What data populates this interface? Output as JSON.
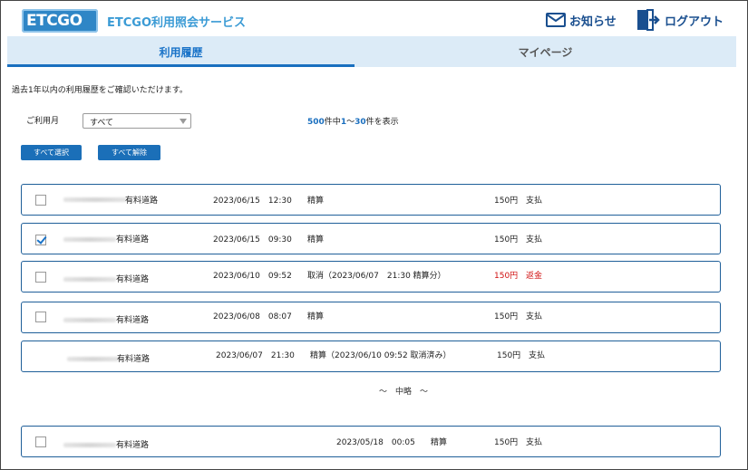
{
  "header": {
    "logo_text": "ETCGO",
    "app_title": "ETCGO利用照会サービス",
    "notice_label": "お知らせ",
    "logout_label": "ログアウト"
  },
  "tabs": [
    {
      "label": "利用履歴",
      "active": true
    },
    {
      "label": "マイページ",
      "active": false
    }
  ],
  "intro_text": "過去1年以内の利用履歴をご確認いただけます。",
  "filter": {
    "month_label": "ご利用月",
    "month_value": "すべて"
  },
  "count": {
    "total": "500",
    "total_suffix": "件中",
    "range_start": "1",
    "range_sep": "～",
    "range_end": "30",
    "range_suffix": "件を表示"
  },
  "buttons": {
    "select_all": "すべて選択",
    "deselect_all": "すべて解除"
  },
  "rows": [
    {
      "road": "有料道路",
      "datetime": "2023/06/15　12:30",
      "type": "精算",
      "amount": "150円",
      "status": "支払",
      "checked": false,
      "has_checkbox": true,
      "red": false
    },
    {
      "road": "有料道路",
      "datetime": "2023/06/15　09:30",
      "type": "精算",
      "amount": "150円",
      "status": "支払",
      "checked": true,
      "has_checkbox": true,
      "red": false
    },
    {
      "road": "有料道路",
      "datetime": "2023/06/10　09:52",
      "type": "取消（2023/06/07　21:30 精算分）",
      "amount": "150円",
      "status": "返金",
      "checked": false,
      "has_checkbox": true,
      "red": true
    },
    {
      "road": "有料道路",
      "datetime": "2023/06/08　08:07",
      "type": "精算",
      "amount": "150円",
      "status": "支払",
      "checked": false,
      "has_checkbox": true,
      "red": false
    },
    {
      "road": "有料道路",
      "datetime": "2023/06/07　21:30",
      "type": "精算（2023/06/10 09:52 取消済み）",
      "amount": "150円",
      "status": "支払",
      "checked": false,
      "has_checkbox": false,
      "red": false
    }
  ],
  "ellipsis": "～　中略　～",
  "last_row": {
    "road": "有料道路",
    "datetime": "2023/05/18　00:05",
    "type": "精算",
    "amount": "150円",
    "status": "支払",
    "checked": false
  },
  "colors": {
    "accent": "#1a6fbf",
    "tab_bg": "#dcebf7",
    "refund_red": "#d01010",
    "logo_blue": "#2f86c6"
  },
  "icons": {
    "notice": "mail-icon",
    "logout": "logout-door-icon",
    "dropdown": "caret-down-icon"
  }
}
